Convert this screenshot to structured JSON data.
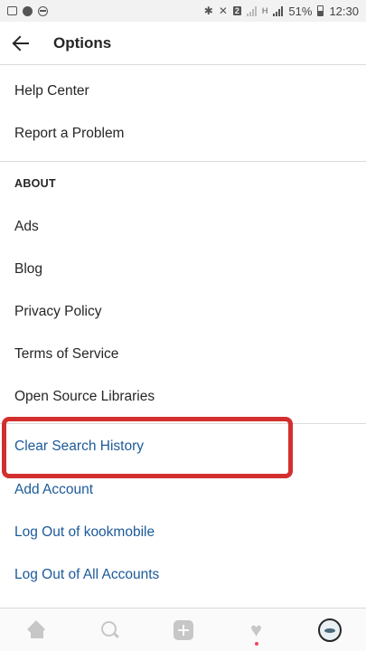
{
  "status_bar": {
    "battery_percent": "51%",
    "time": "12:30",
    "notification_badge": "2",
    "network_type": "H"
  },
  "header": {
    "title": "Options"
  },
  "menu": {
    "support_items": [
      "Help Center",
      "Report a Problem"
    ],
    "about_header": "ABOUT",
    "about_items": [
      "Ads",
      "Blog",
      "Privacy Policy",
      "Terms of Service",
      "Open Source Libraries"
    ],
    "account_items": [
      "Clear Search History",
      "Add Account",
      "Log Out of kookmobile",
      "Log Out of All Accounts"
    ]
  },
  "colors": {
    "link_blue": "#1c5a99",
    "highlight_red": "#d32f2f",
    "text_dark": "#262626",
    "icon_gray": "#c7c7c7"
  },
  "bottom_nav": {
    "icons": [
      "home-icon",
      "search-icon",
      "add-post-icon",
      "activity-heart-icon",
      "profile-avatar"
    ],
    "has_activity_notification": true
  }
}
